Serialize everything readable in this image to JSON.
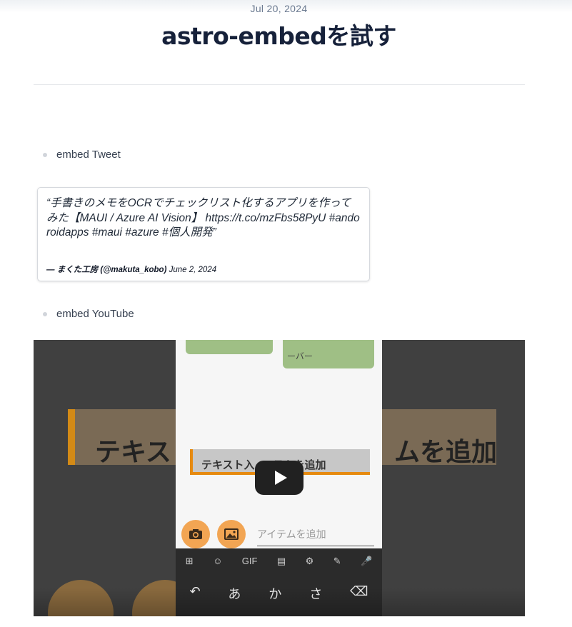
{
  "post": {
    "date": "Jul 20, 2024",
    "title": "astro-embedを試す"
  },
  "items": [
    {
      "label": "embed Tweet"
    },
    {
      "label": "embed YouTube"
    }
  ],
  "tweet": {
    "text": "“手書きのメモをOCRでチェックリスト化するアプリを作ってみた【MAUI / Azure AI Vision】 https://t.co/mzFbs58PyU #andoroidapps #maui #azure #個人開発”",
    "author": "— まくた工房 (@makuta_kobo)",
    "date": "June 2, 2024"
  },
  "video": {
    "frame_text_left": "テキス",
    "frame_text_right": "ムを追加",
    "phone_band_text": "テキスト入 　 テムを追加",
    "add_item_placeholder": "アイテムを追加",
    "keyboard_toolbar": [
      "⊞",
      "☺",
      "GIF",
      "▤",
      "⚙",
      "✎",
      "🎤"
    ],
    "keyboard_keys": [
      "↶",
      "あ",
      "か",
      "さ",
      "⌫"
    ],
    "green_card_text": "ーバー"
  },
  "colors": {
    "title": "#16213a",
    "date": "#6b7a90",
    "play_button": "#212121",
    "accent_orange": "#e68a10"
  }
}
